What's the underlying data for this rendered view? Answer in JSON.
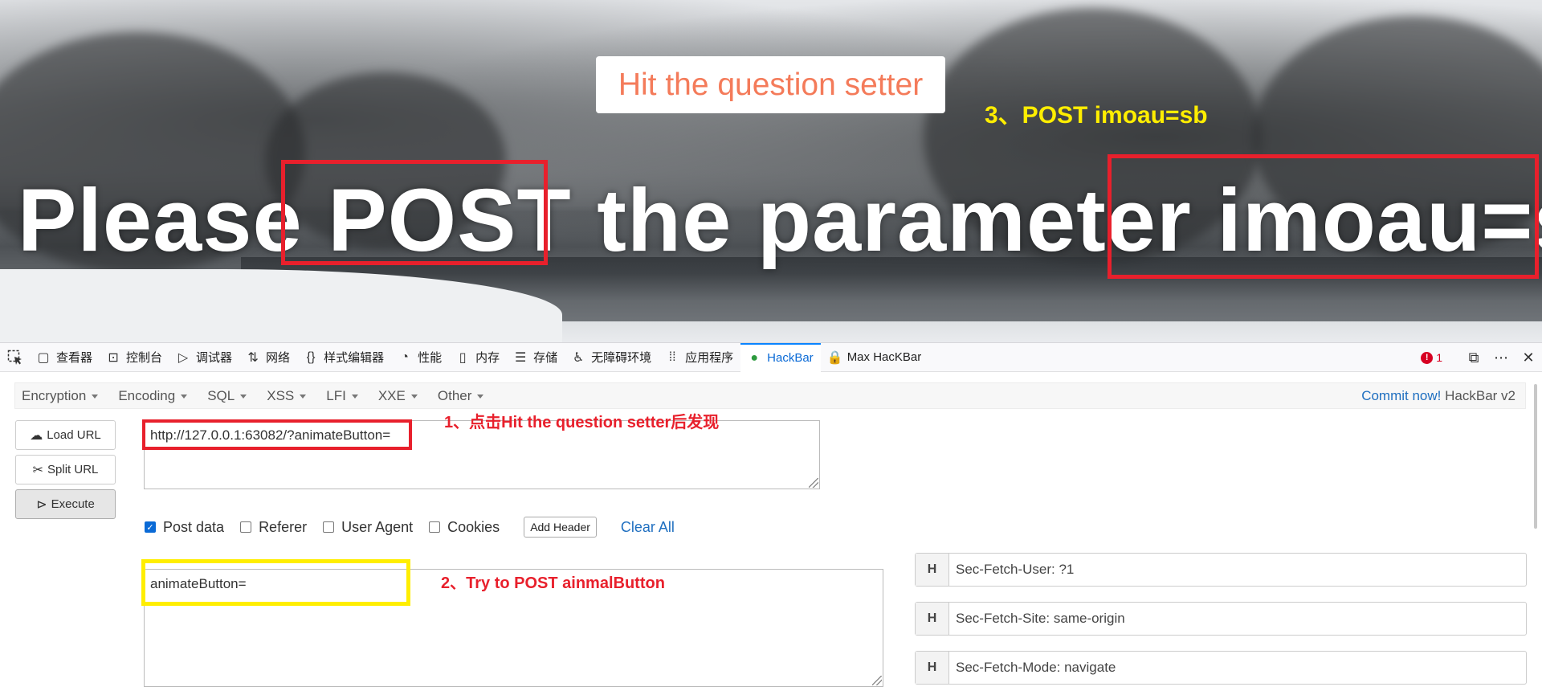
{
  "viewport": {
    "setter_button": "Hit the question setter",
    "headline": "Please POST the parameter imoau=sb",
    "annotation_3": "3、POST imoau=sb"
  },
  "devtools": {
    "tabs": [
      {
        "label": "查看器",
        "icon": "inspector-icon"
      },
      {
        "label": "控制台",
        "icon": "console-icon"
      },
      {
        "label": "调试器",
        "icon": "debugger-icon"
      },
      {
        "label": "网络",
        "icon": "network-icon"
      },
      {
        "label": "样式编辑器",
        "icon": "style-editor-icon"
      },
      {
        "label": "性能",
        "icon": "performance-icon"
      },
      {
        "label": "内存",
        "icon": "memory-icon"
      },
      {
        "label": "存储",
        "icon": "storage-icon"
      },
      {
        "label": "无障碍环境",
        "icon": "accessibility-icon"
      },
      {
        "label": "应用程序",
        "icon": "application-icon"
      },
      {
        "label": "HackBar",
        "icon": "hackbar-icon"
      },
      {
        "label": "Max HacKBar",
        "icon": "max-hackbar-icon"
      }
    ],
    "error_count": "1",
    "accent_color": "#0a84ff"
  },
  "hackbar": {
    "menu": [
      "Encryption",
      "Encoding",
      "SQL",
      "XSS",
      "LFI",
      "XXE",
      "Other"
    ],
    "commit_link": "Commit now!",
    "version": "HackBar v2",
    "buttons": {
      "load": "Load URL",
      "split": "Split URL",
      "execute": "Execute"
    },
    "url_value": "http://127.0.0.1:63082/?animateButton=",
    "options": {
      "post_data": "Post data",
      "referer": "Referer",
      "user_agent": "User Agent",
      "cookies": "Cookies",
      "add_header": "Add Header",
      "clear_all": "Clear All",
      "post_data_checked": true
    },
    "post_body": "animateButton=",
    "headers": [
      {
        "key": "H",
        "value": "Sec-Fetch-User: ?1"
      },
      {
        "key": "H",
        "value": "Sec-Fetch-Site: same-origin"
      },
      {
        "key": "H",
        "value": "Sec-Fetch-Mode: navigate"
      }
    ]
  },
  "annotations": {
    "step_1": "1、点击Hit the question setter后发现",
    "step_2": "2、Try to POST ainmalButton",
    "box_color_red": "#e8202c",
    "box_color_yellow": "#ffee00"
  }
}
